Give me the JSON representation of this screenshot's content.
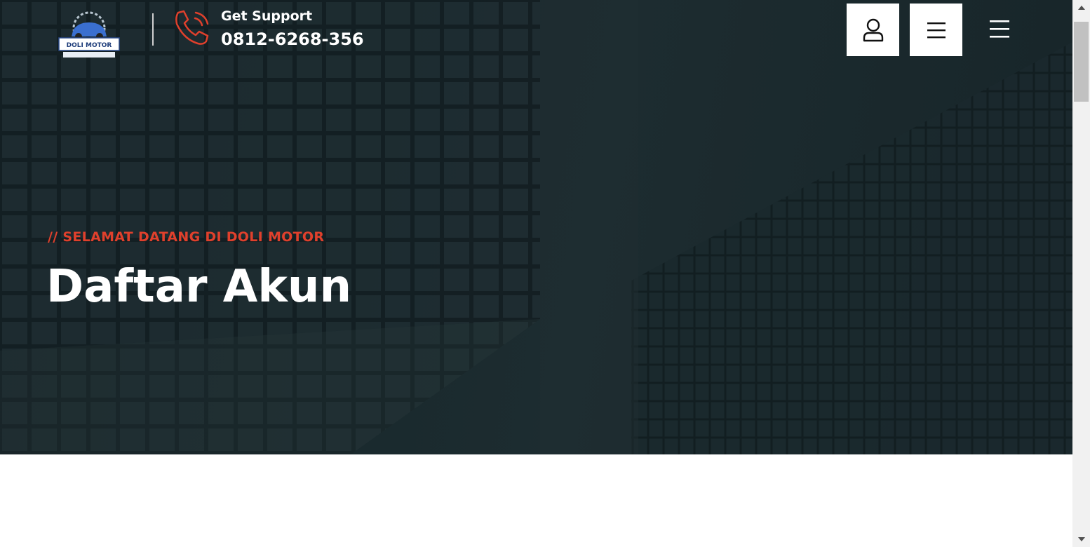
{
  "header": {
    "logo_text": "DOLI MOTOR",
    "support_label": "Get Support",
    "support_phone": "0812-6268-356",
    "icons": {
      "phone": "phone-ringing-icon",
      "user": "user-icon",
      "menu": "menu-icon",
      "burger": "hamburger-icon"
    }
  },
  "hero": {
    "eyebrow": "// SELAMAT DATANG DI DOLI MOTOR",
    "title": "Daftar Akun"
  },
  "colors": {
    "accent": "#e0402c",
    "hero_bg": "#1a2a2e",
    "button_bg": "#ffffff",
    "text_light": "#ffffff"
  }
}
